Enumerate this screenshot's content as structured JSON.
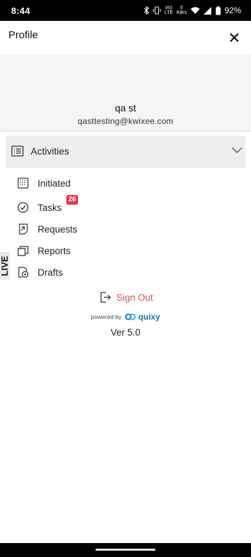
{
  "status_bar": {
    "time": "8:44",
    "network_label_top": "Vo)",
    "network_label_bottom": "LTE",
    "data_rate_top": "0",
    "data_rate_bottom": "KB/s",
    "battery": "92%"
  },
  "header": {
    "title": "Profile",
    "close_icon": "close-icon"
  },
  "profile": {
    "name": "qa st",
    "email": "qasttesting@kwixee.com"
  },
  "menu": {
    "section_label": "Activities",
    "section_icon": "list-icon",
    "items": [
      {
        "label": "Initiated",
        "icon": "calendar-grid-icon"
      },
      {
        "label": "Tasks",
        "icon": "check-circle-icon",
        "badge": "26"
      },
      {
        "label": "Requests",
        "icon": "request-icon"
      },
      {
        "label": "Reports",
        "icon": "reports-icon"
      },
      {
        "label": "Drafts",
        "icon": "drafts-icon"
      }
    ]
  },
  "environment_tab": "LIVE",
  "signout": {
    "label": "Sign Out",
    "icon": "sign-out-icon"
  },
  "powered_by": {
    "text": "powered by",
    "brand": "quixy"
  },
  "version": "Ver 5.0",
  "colors": {
    "signout": "#d9534f",
    "badge": "#e63946",
    "brand": "#1a6fb5",
    "activities_bg": "#eeeeee",
    "profile_bg": "#f5f5f5"
  }
}
